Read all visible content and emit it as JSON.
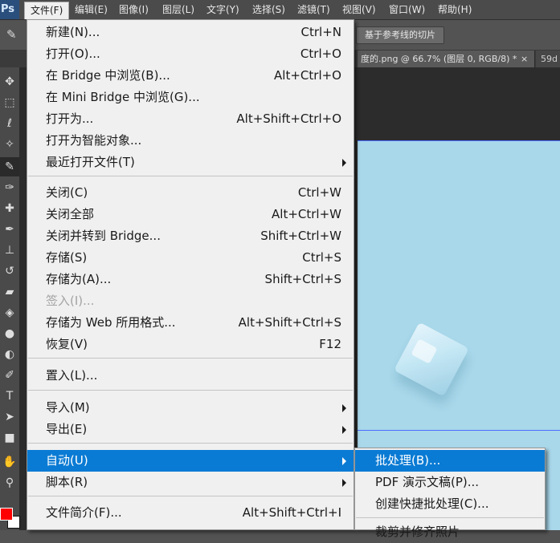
{
  "app": {
    "logo": "Ps"
  },
  "menubar": [
    {
      "label": "文件(F)",
      "active": true
    },
    {
      "label": "编辑(E)"
    },
    {
      "label": "图像(I)"
    },
    {
      "label": "图层(L)"
    },
    {
      "label": "文字(Y)"
    },
    {
      "label": "选择(S)"
    },
    {
      "label": "滤镜(T)"
    },
    {
      "label": "视图(V)"
    },
    {
      "label": "窗口(W)"
    },
    {
      "label": "帮助(H)"
    }
  ],
  "options_bar": {
    "slice_button": "基于参考线的切片"
  },
  "doc_tabs": [
    {
      "label": "度的.png @ 66.7% (图层 0, RGB/8) *",
      "close": "×"
    },
    {
      "label": "59d"
    }
  ],
  "file_menu": {
    "items": [
      {
        "label": "新建(N)...",
        "shortcut": "Ctrl+N"
      },
      {
        "label": "打开(O)...",
        "shortcut": "Ctrl+O"
      },
      {
        "label": "在 Bridge 中浏览(B)...",
        "shortcut": "Alt+Ctrl+O"
      },
      {
        "label": "在 Mini Bridge 中浏览(G)...",
        "shortcut": ""
      },
      {
        "label": "打开为...",
        "shortcut": "Alt+Shift+Ctrl+O"
      },
      {
        "label": "打开为智能对象...",
        "shortcut": ""
      },
      {
        "label": "最近打开文件(T)",
        "shortcut": "",
        "submenu": true
      },
      {
        "label": "关闭(C)",
        "shortcut": "Ctrl+W"
      },
      {
        "label": "关闭全部",
        "shortcut": "Alt+Ctrl+W"
      },
      {
        "label": "关闭并转到 Bridge...",
        "shortcut": "Shift+Ctrl+W"
      },
      {
        "label": "存储(S)",
        "shortcut": "Ctrl+S"
      },
      {
        "label": "存储为(A)...",
        "shortcut": "Shift+Ctrl+S"
      },
      {
        "label": "签入(I)...",
        "shortcut": "",
        "disabled": true
      },
      {
        "label": "存储为 Web 所用格式...",
        "shortcut": "Alt+Shift+Ctrl+S"
      },
      {
        "label": "恢复(V)",
        "shortcut": "F12"
      },
      {
        "label": "置入(L)...",
        "shortcut": ""
      },
      {
        "label": "导入(M)",
        "shortcut": "",
        "submenu": true
      },
      {
        "label": "导出(E)",
        "shortcut": "",
        "submenu": true
      },
      {
        "label": "自动(U)",
        "shortcut": "",
        "submenu": true,
        "highlighted": true
      },
      {
        "label": "脚本(R)",
        "shortcut": "",
        "submenu": true
      },
      {
        "label": "文件简介(F)...",
        "shortcut": "Alt+Shift+Ctrl+I"
      }
    ]
  },
  "auto_submenu": {
    "items": [
      {
        "label": "批处理(B)...",
        "highlighted": true
      },
      {
        "label": "PDF 演示文稿(P)..."
      },
      {
        "label": "创建快捷批处理(C)..."
      },
      {
        "label": "裁剪并修齐照片"
      }
    ]
  },
  "colors": {
    "accent": "#0a7bd4",
    "foreground_swatch": "#ff0000",
    "background_swatch": "#ffffff",
    "canvas": "#a9d8ea"
  }
}
